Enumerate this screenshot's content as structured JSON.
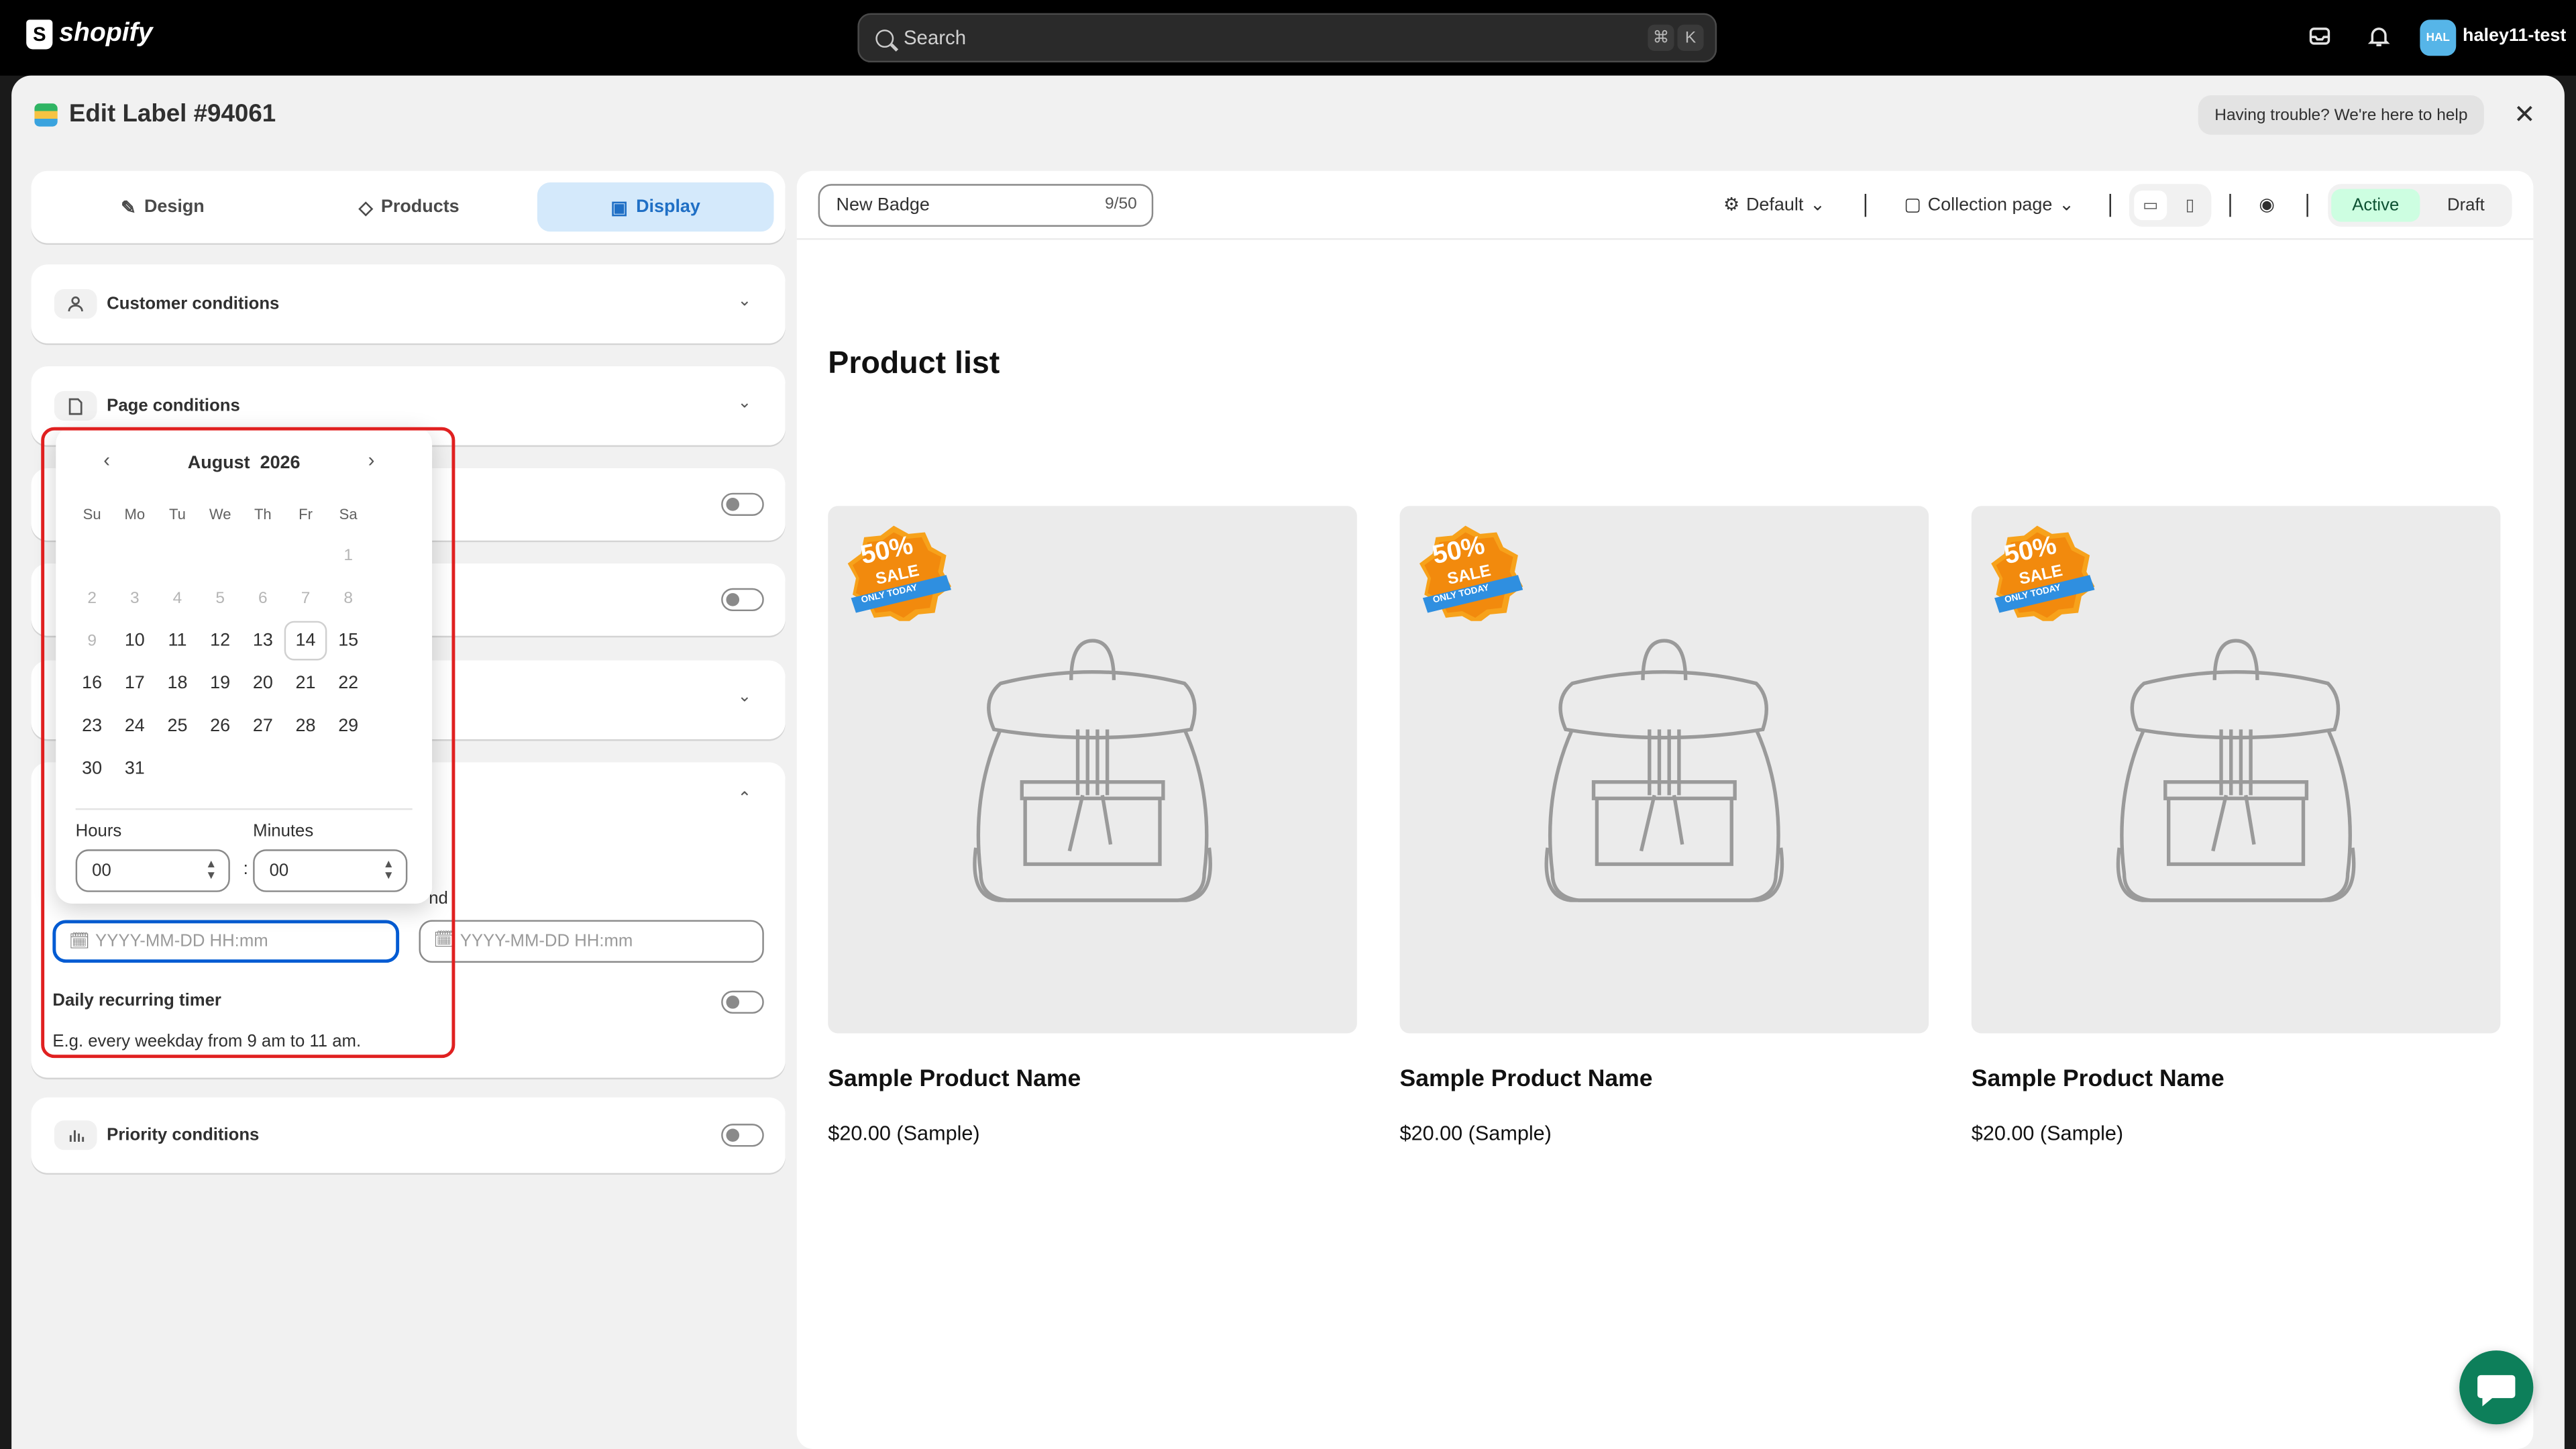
{
  "topbar": {
    "logo_text": "shopify",
    "search_placeholder": "Search",
    "shortcut_key1": "⌘",
    "shortcut_key2": "K",
    "avatar_initials": "HAL",
    "store_name": "haley11-test"
  },
  "header": {
    "title": "Edit Label #94061",
    "help_text": "Having trouble? We're here to help",
    "close_symbol": "✕"
  },
  "tabs": [
    {
      "label": "Design",
      "icon": "magic-wand-icon"
    },
    {
      "label": "Products",
      "icon": "tag-icon"
    },
    {
      "label": "Display",
      "icon": "image-icon",
      "active": true
    }
  ],
  "sections": {
    "customer": "Customer conditions",
    "page": "Page conditions",
    "priority": "Priority conditions"
  },
  "schedule": {
    "end_label_fragment": "nd",
    "start_placeholder": "YYYY-MM-DD HH:mm",
    "end_placeholder": "YYYY-MM-DD HH:mm",
    "recurring_label": "Daily recurring timer",
    "recurring_help": "E.g. every weekday from 9 am to 11 am."
  },
  "datepicker": {
    "month": "August",
    "year": "2026",
    "weekdays": [
      "Su",
      "Mo",
      "Tu",
      "We",
      "Th",
      "Fr",
      "Sa"
    ],
    "disabled_days": [
      "1",
      "2",
      "3",
      "4",
      "5",
      "6",
      "7",
      "8",
      "9"
    ],
    "enabled_days": [
      "10",
      "11",
      "12",
      "13",
      "14",
      "15",
      "16",
      "17",
      "18",
      "19",
      "20",
      "21",
      "22",
      "23",
      "24",
      "25",
      "26",
      "27",
      "28",
      "29",
      "30",
      "31"
    ],
    "today": "14",
    "hours_label": "Hours",
    "minutes_label": "Minutes",
    "hours_value": "00",
    "minutes_value": "00",
    "colon": ":"
  },
  "preview": {
    "badge_name": "New Badge",
    "char_count": "9/50",
    "template": "Default",
    "page_type": "Collection page",
    "status_active": "Active",
    "status_draft": "Draft",
    "list_title": "Product list",
    "badge_text_main": "50%",
    "badge_text_sale": "SALE",
    "badge_text_ribbon": "ONLY TODAY",
    "products": [
      {
        "name": "Sample Product Name",
        "price": "$20.00 (Sample)"
      },
      {
        "name": "Sample Product Name",
        "price": "$20.00 (Sample)"
      },
      {
        "name": "Sample Product Name",
        "price": "$20.00 (Sample)"
      }
    ]
  },
  "colors": {
    "accent": "#005bd3",
    "tab_active_bg": "#d4e9fb",
    "active_status_bg": "#cdfee1",
    "highlight": "#e02020",
    "chat": "#0d7f5a"
  }
}
